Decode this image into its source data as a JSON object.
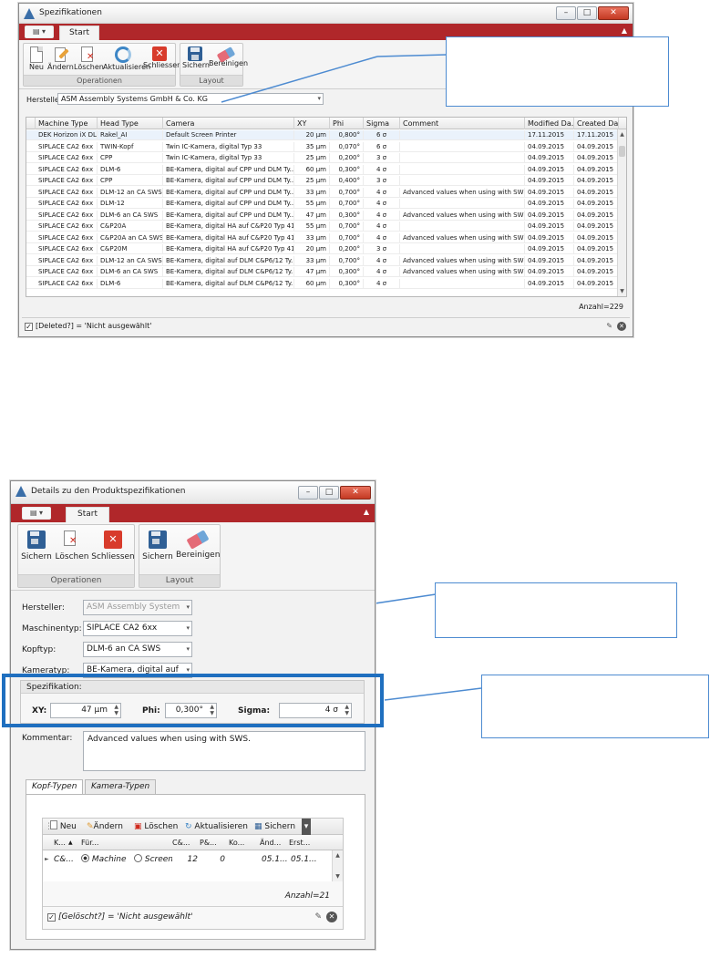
{
  "win1": {
    "title": "Spezifikationen",
    "ribbon_tab": "Start",
    "groups": {
      "operationen": "Operationen",
      "layout": "Layout"
    },
    "buttons": {
      "neu": "Neu",
      "aendern": "Ändern",
      "loeschen": "Löschen",
      "aktualisieren": "Aktualisieren",
      "schliessen": "Schliessen",
      "sichern": "Sichern",
      "bereinigen": "Bereinigen"
    },
    "hersteller_label": "Hersteller:",
    "hersteller_value": "ASM Assembly Systems GmbH & Co. KG",
    "columns": [
      "Machine Type",
      "Head Type",
      "Camera",
      "XY",
      "Phi",
      "Sigma",
      "Comment",
      "Modified Da...",
      "Created Date"
    ],
    "rows": [
      [
        "DEK Horizon iX DL",
        "Rakel_AI",
        "Default Screen Printer",
        "20 µm",
        "0,800°",
        "6 σ",
        "",
        "17.11.2015",
        "17.11.2015"
      ],
      [
        "SIPLACE CA2 6xx",
        "TWIN-Kopf",
        "Twin IC-Kamera, digital Typ 33",
        "35 µm",
        "0,070°",
        "6 σ",
        "",
        "04.09.2015",
        "04.09.2015"
      ],
      [
        "SIPLACE CA2 6xx",
        "CPP",
        "Twin IC-Kamera, digital Typ 33",
        "25 µm",
        "0,200°",
        "3 σ",
        "",
        "04.09.2015",
        "04.09.2015"
      ],
      [
        "SIPLACE CA2 6xx",
        "DLM-6",
        "BE-Kamera, digital auf CPP und DLM Ty...",
        "60 µm",
        "0,300°",
        "4 σ",
        "",
        "04.09.2015",
        "04.09.2015"
      ],
      [
        "SIPLACE CA2 6xx",
        "CPP",
        "BE-Kamera, digital auf CPP und DLM Ty...",
        "25 µm",
        "0,400°",
        "3 σ",
        "",
        "04.09.2015",
        "04.09.2015"
      ],
      [
        "SIPLACE CA2 6xx",
        "DLM-12 an CA SWS",
        "BE-Kamera, digital auf CPP und DLM Ty...",
        "33 µm",
        "0,700°",
        "4 σ",
        "Advanced values when using with SWS.",
        "04.09.2015",
        "04.09.2015"
      ],
      [
        "SIPLACE CA2 6xx",
        "DLM-12",
        "BE-Kamera, digital auf CPP und DLM Ty...",
        "55 µm",
        "0,700°",
        "4 σ",
        "",
        "04.09.2015",
        "04.09.2015"
      ],
      [
        "SIPLACE CA2 6xx",
        "DLM-6 an CA SWS",
        "BE-Kamera, digital auf CPP und DLM Ty...",
        "47 µm",
        "0,300°",
        "4 σ",
        "Advanced values when using with SWS.",
        "04.09.2015",
        "04.09.2015"
      ],
      [
        "SIPLACE CA2 6xx",
        "C&P20A",
        "BE-Kamera, digital HA auf C&P20 Typ 41",
        "55 µm",
        "0,700°",
        "4 σ",
        "",
        "04.09.2015",
        "04.09.2015"
      ],
      [
        "SIPLACE CA2 6xx",
        "C&P20A an CA SWS",
        "BE-Kamera, digital HA auf C&P20 Typ 41",
        "33 µm",
        "0,700°",
        "4 σ",
        "Advanced values when using with SWS.",
        "04.09.2015",
        "04.09.2015"
      ],
      [
        "SIPLACE CA2 6xx",
        "C&P20M",
        "BE-Kamera, digital HA auf C&P20 Typ 41",
        "20 µm",
        "0,200°",
        "3 σ",
        "",
        "04.09.2015",
        "04.09.2015"
      ],
      [
        "SIPLACE CA2 6xx",
        "DLM-12 an CA SWS",
        "BE-Kamera, digital auf DLM C&P6/12 Ty...",
        "33 µm",
        "0,700°",
        "4 σ",
        "Advanced values when using with SWS.",
        "04.09.2015",
        "04.09.2015"
      ],
      [
        "SIPLACE CA2 6xx",
        "DLM-6 an CA SWS",
        "BE-Kamera, digital auf DLM C&P6/12 Ty...",
        "47 µm",
        "0,300°",
        "4 σ",
        "Advanced values when using with SWS.",
        "04.09.2015",
        "04.09.2015"
      ],
      [
        "SIPLACE CA2 6xx",
        "DLM-6",
        "BE-Kamera, digital auf DLM C&P6/12 Ty...",
        "60 µm",
        "0,300°",
        "4 σ",
        "",
        "04.09.2015",
        "04.09.2015"
      ]
    ],
    "count": "Anzahl=229",
    "filter": "[Deleted?] = 'Nicht ausgewählt'"
  },
  "win2": {
    "title": "Details zu den Produktspezifikationen",
    "ribbon_tab": "Start",
    "groups": {
      "operationen": "Operationen",
      "layout": "Layout"
    },
    "buttons": {
      "sichern": "Sichern",
      "loeschen": "Löschen",
      "schliessen": "Schliessen",
      "sichern2": "Sichern",
      "bereinigen": "Bereinigen"
    },
    "labels": {
      "hersteller": "Hersteller:",
      "maschinentyp": "Maschinentyp:",
      "kopftyp": "Kopftyp:",
      "kameratyp": "Kameratyp:",
      "spezifikation": "Spezifikation:",
      "xy": "XY:",
      "phi": "Phi:",
      "sigma": "Sigma:",
      "kommentar": "Kommentar:"
    },
    "values": {
      "hersteller": "ASM Assembly System",
      "maschinentyp": "SIPLACE CA2 6xx",
      "kopftyp": "DLM-6 an CA SWS",
      "kameratyp": "BE-Kamera, digital auf",
      "xy": "47 µm",
      "phi": "0,300°",
      "sigma": "4 σ",
      "kommentar": "Advanced values when using with SWS."
    },
    "subtabs": [
      "Kopf-Typen",
      "Kamera-Typen"
    ],
    "subtoolbar": {
      "neu": "Neu",
      "aendern": "Ändern",
      "loeschen": "Löschen",
      "aktualisieren": "Aktualisieren",
      "sichern": "Sichern"
    },
    "subgrid": {
      "columns": [
        "K...",
        "Für...",
        "C&...",
        "P&...",
        "Ko...",
        "Änd...",
        "Erst..."
      ],
      "row": {
        "k": "C&...",
        "radio1": "Machine",
        "radio2": "Screen I",
        "c": "12",
        "p": "0",
        "ko": "",
        "aend": "05.1...",
        "erst": "05.1..."
      }
    },
    "count": "Anzahl=21",
    "filter": "[Gelöscht?] = 'Nicht ausgewählt'"
  },
  "colors": {
    "ribbon_red": "#b0272a",
    "callout_blue": "#4d8bd1",
    "highlight_blue": "#1f6fbf"
  }
}
